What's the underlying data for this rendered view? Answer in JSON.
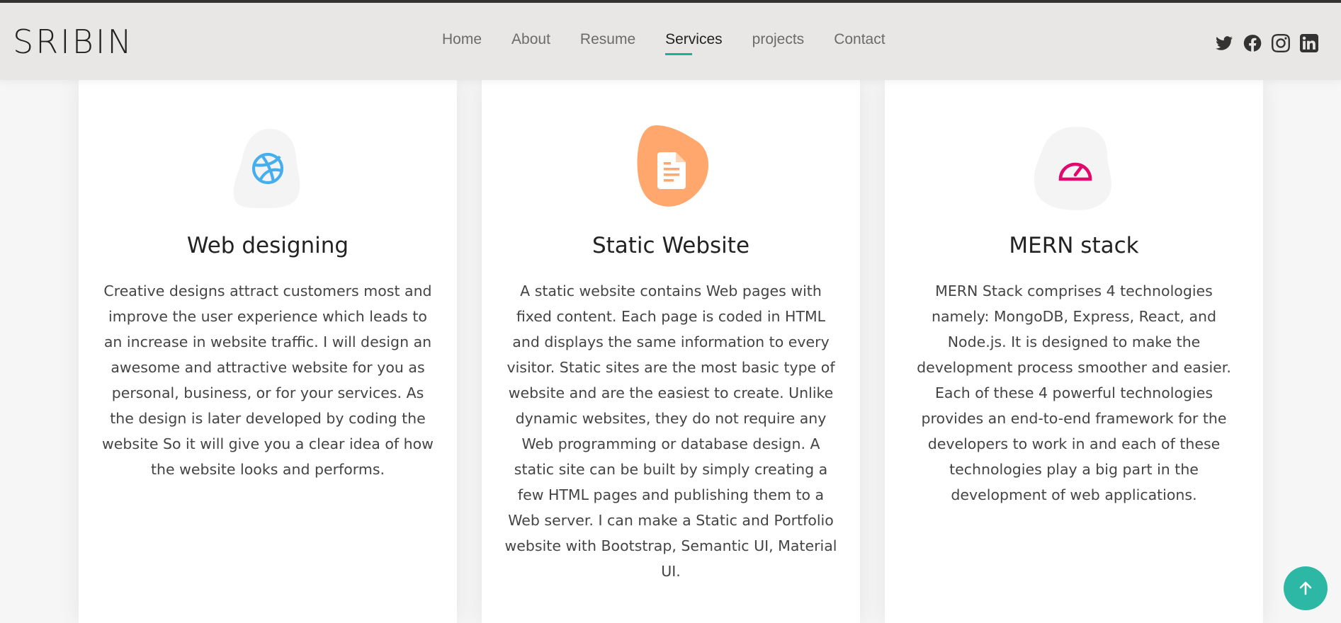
{
  "brand": "SRIBIN",
  "nav": {
    "items": [
      {
        "label": "Home"
      },
      {
        "label": "About"
      },
      {
        "label": "Resume"
      },
      {
        "label": "Services",
        "active": true
      },
      {
        "label": "projects"
      },
      {
        "label": "Contact"
      }
    ],
    "active_color": "#1fae9e"
  },
  "social": [
    "twitter-icon",
    "facebook-icon",
    "instagram-icon",
    "linkedin-icon"
  ],
  "services": [
    {
      "title": "Web designing",
      "icon": "dribbble-icon",
      "icon_color": "#47aeee",
      "blob_color": "#f4f4f4",
      "description": "Creative designs attract customers most and improve the user experience which leads to an increase in website traffic. I will design an awesome and attractive website for you as personal, business, or for your services. As the design is later developed by coding the website So it will give you a clear idea of how the website looks and performs."
    },
    {
      "title": "Static Website",
      "icon": "file-document-icon",
      "icon_color": "#ffffff",
      "blob_color": "#ffa76c",
      "description": "A static website contains Web pages with fixed content. Each page is coded in HTML and displays the same information to every visitor. Static sites are the most basic type of website and are the easiest to create. Unlike dynamic websites, they do not require any Web programming or database design. A static site can be built by simply creating a few HTML pages and publishing them to a Web server. I can make a Static and Portfolio website with Bootstrap, Semantic UI, Material UI."
    },
    {
      "title": "MERN stack",
      "icon": "speedometer-icon",
      "icon_color": "#e1096d",
      "blob_color": "#f4f4f4",
      "description": "MERN Stack comprises 4 technologies namely: MongoDB, Express, React, and Node.js. It is designed to make the development process smoother and easier. Each of these 4 powerful technologies provides an end-to-end framework for the developers to work in and each of these technologies play a big part in the development of web applications."
    }
  ],
  "back_to_top": {
    "icon": "arrow-up-icon",
    "color": "#2db7a5"
  }
}
